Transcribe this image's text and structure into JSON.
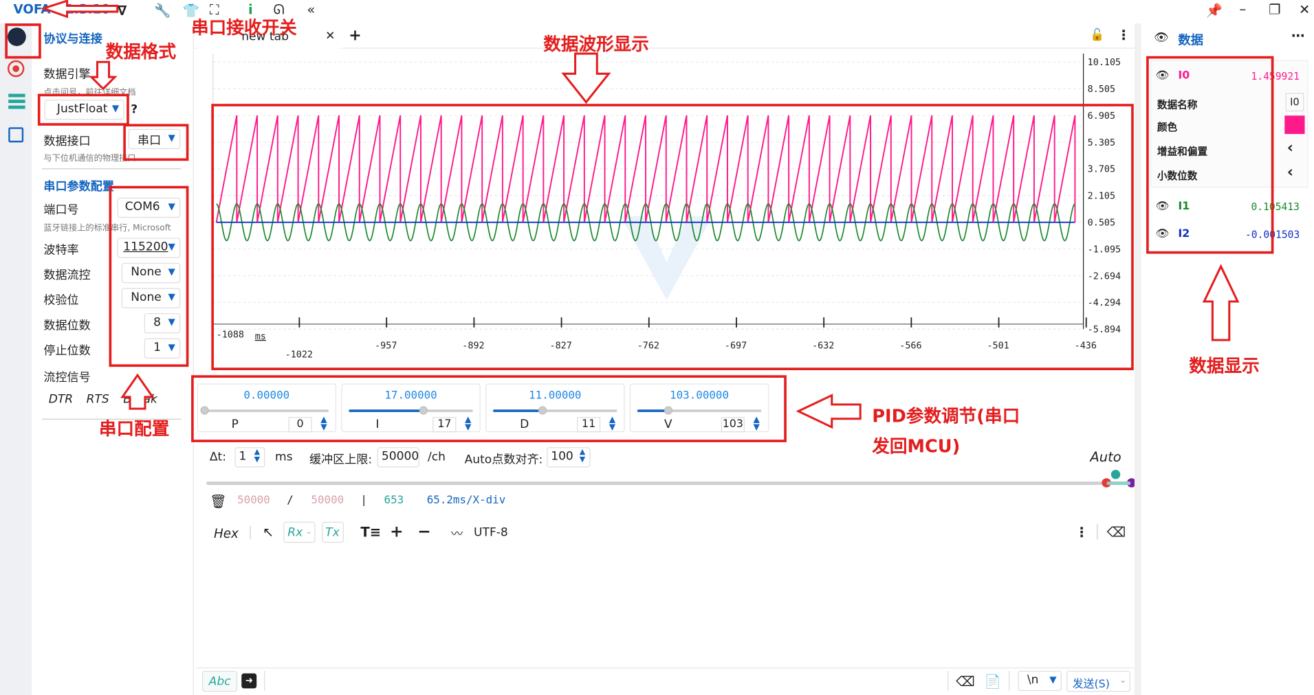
{
  "app": {
    "title": "VOFA+ 1.3.10"
  },
  "tab": {
    "name": "new tab"
  },
  "left": {
    "section_title": "协议与连接",
    "engine_label": "数据引擎",
    "engine_hint": "点击问号，前往详细文档",
    "engine_value": "JustFloat",
    "help": "?",
    "iface_label": "数据接口",
    "iface_value": "串口",
    "iface_hint": "与下位机通信的物理接口",
    "serial_title": "串口参数配置",
    "port_label": "端口号",
    "port_value": "COM6",
    "port_hint": "蓝牙链接上的标准串行, Microsoft",
    "baud_label": "波特率",
    "baud_value": "115200",
    "flow_label": "数据流控",
    "flow_value": "None",
    "parity_label": "校验位",
    "parity_value": "None",
    "databits_label": "数据位数",
    "databits_value": "8",
    "stopbits_label": "停止位数",
    "stopbits_value": "1",
    "flowsig_label": "流控信号",
    "dtr": "DTR",
    "rts": "RTS",
    "brk": "Break"
  },
  "annotations": {
    "a1": "串口接收开关",
    "a2": "数据格式",
    "a3": "数据波形显示",
    "a4": "串口配置",
    "a5": "PID参数调节(串口",
    "a5b": "发回MCU)",
    "a6": "数据显示"
  },
  "chart_data": {
    "type": "line",
    "y_ticks": [
      "10.105",
      "8.505",
      "6.905",
      "5.305",
      "3.705",
      "2.105",
      "0.505",
      "-1.095",
      "-2.694",
      "-4.294",
      "-5.894"
    ],
    "x_ticks_row1": [
      "-957",
      "-892",
      "-827",
      "-762",
      "-697",
      "-632",
      "-566",
      "-501",
      "-436"
    ],
    "x_start": "-1088",
    "x_unit": "ms",
    "x_second": "-1022",
    "ylim": [
      -5.894,
      10.105
    ],
    "series": [
      {
        "name": "I0",
        "color": "#ff1a8c",
        "kind": "sawtooth",
        "min": 0.505,
        "max": 6.905,
        "cycles": 42
      },
      {
        "name": "I1",
        "color": "#1a8a2a",
        "kind": "sine",
        "center": 0.505,
        "amp": 1.1,
        "cycles": 42
      },
      {
        "name": "I2",
        "color": "#1030c8",
        "kind": "flat",
        "value": 0.505
      }
    ]
  },
  "pid": [
    {
      "value": "0.00000",
      "name": "P",
      "num": "0",
      "frac": 0.0
    },
    {
      "value": "17.00000",
      "name": "I",
      "num": "17",
      "frac": 0.6
    },
    {
      "value": "11.00000",
      "name": "D",
      "num": "11",
      "frac": 0.4
    },
    {
      "value": "103.00000",
      "name": "V",
      "num": "103",
      "frac": 0.25
    }
  ],
  "settings": {
    "dt_label": "Δt:",
    "dt_value": "1",
    "dt_unit": "ms",
    "buf_label": "缓冲区上限:",
    "buf_value": "50000",
    "buf_unit": "/ch",
    "auto_label": "Auto点数对齐:",
    "auto_value": "100",
    "auto": "Auto"
  },
  "status": {
    "a": "50000",
    "sep1": "/",
    "b": "50000",
    "sep2": "|",
    "c": "653",
    "d": "65.2ms/X-div"
  },
  "toolbar2": {
    "hex": "Hex",
    "rx": "Rx",
    "tx": "Tx",
    "enc": "UTF-8"
  },
  "bottom": {
    "abc": "Abc",
    "newline": "\\n",
    "send": "发送(S)"
  },
  "right": {
    "title": "数据",
    "ch0": {
      "name": "I0",
      "value": "1.459921"
    },
    "name_label": "数据名称",
    "name_value": "I0",
    "color_label": "颜色",
    "gain_label": "增益和偏置",
    "dec_label": "小数位数",
    "ch1": {
      "name": "I1",
      "value": "0.105413"
    },
    "ch2": {
      "name": "I2",
      "value": "-0.001503"
    }
  }
}
